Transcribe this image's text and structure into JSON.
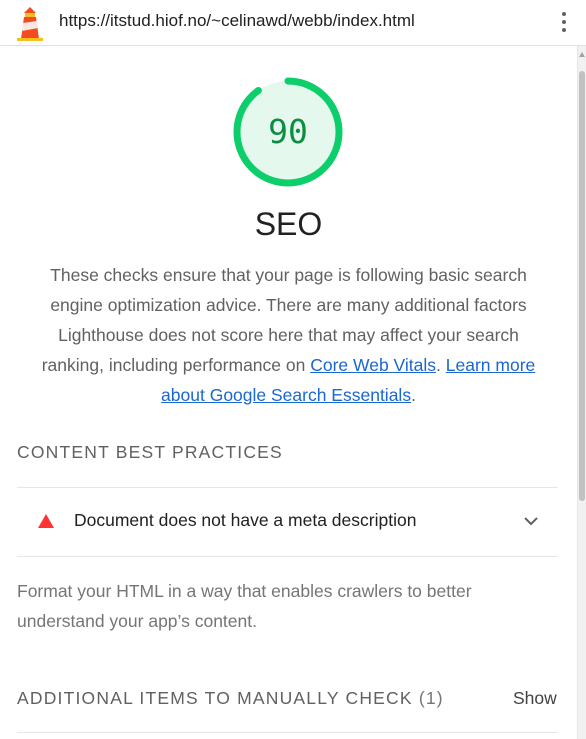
{
  "browser": {
    "url": "https://itstud.hiof.no/~celinawd/webb/index.html",
    "logo_icon": "lighthouse-icon",
    "menu_icon": "more-vert-icon"
  },
  "category": {
    "score": "90",
    "score_fraction": 0.9,
    "score_color": "#0cce6b",
    "title": "SEO",
    "description_before": "These checks ensure that your page is following basic search engine optimization advice. There are many additional factors Lighthouse does not score here that may affect your search ranking, including performance on ",
    "link_core_web_vitals": "Core Web Vitals",
    "description_middle": ". ",
    "link_learn_more": "Learn more about Google Search Essentials",
    "description_after": "."
  },
  "content_group": {
    "title": "CONTENT BEST PRACTICES",
    "audit": {
      "title": "Document does not have a meta description",
      "status_icon": "fail-triangle-icon",
      "status_color": "#ff3333",
      "expand_icon": "chevron-down-icon"
    },
    "description": "Format your HTML in a way that enables crawlers to better understand your app’s content."
  },
  "manual_group": {
    "title": "ADDITIONAL ITEMS TO MANUALLY CHECK",
    "count": "(1)",
    "show_label": "Show"
  }
}
